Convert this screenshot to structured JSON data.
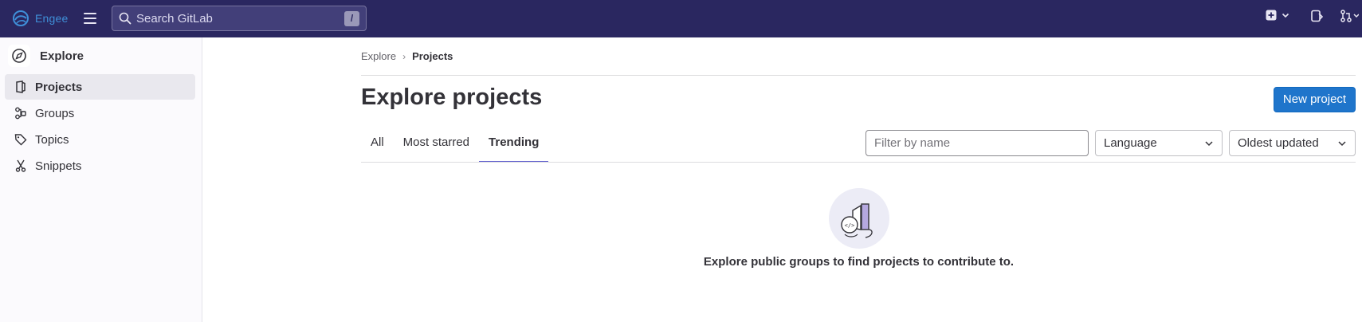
{
  "topbar": {
    "brand_name": "Engee",
    "search_placeholder": "Search GitLab",
    "search_shortcut": "/",
    "icons": [
      "engee-logo-icon",
      "hamburger-menu-icon",
      "search-icon",
      "create-new-icon",
      "chevron-down-icon",
      "issues-icon",
      "merge-requests-icon"
    ]
  },
  "sidebar": {
    "title": "Explore",
    "items": [
      {
        "label": "Projects",
        "icon": "project-icon",
        "active": true
      },
      {
        "label": "Groups",
        "icon": "group-icon",
        "active": false
      },
      {
        "label": "Topics",
        "icon": "label-icon",
        "active": false
      },
      {
        "label": "Snippets",
        "icon": "snippet-icon",
        "active": false
      }
    ]
  },
  "breadcrumb": {
    "parent": "Explore",
    "current": "Projects"
  },
  "main": {
    "title": "Explore projects",
    "new_project_label": "New project",
    "tabs": [
      {
        "label": "All",
        "active": false
      },
      {
        "label": "Most starred",
        "active": false
      },
      {
        "label": "Trending",
        "active": true
      }
    ],
    "filter_placeholder": "Filter by name",
    "language_dropdown": "Language",
    "sort_dropdown": "Oldest updated",
    "empty_state_text": "Explore public groups to find projects to contribute to."
  },
  "colors": {
    "topbar_bg": "#2a2760",
    "primary_button": "#1f75cb",
    "active_tab_underline": "#6160ce",
    "sidebar_bg": "#fbfafd"
  }
}
